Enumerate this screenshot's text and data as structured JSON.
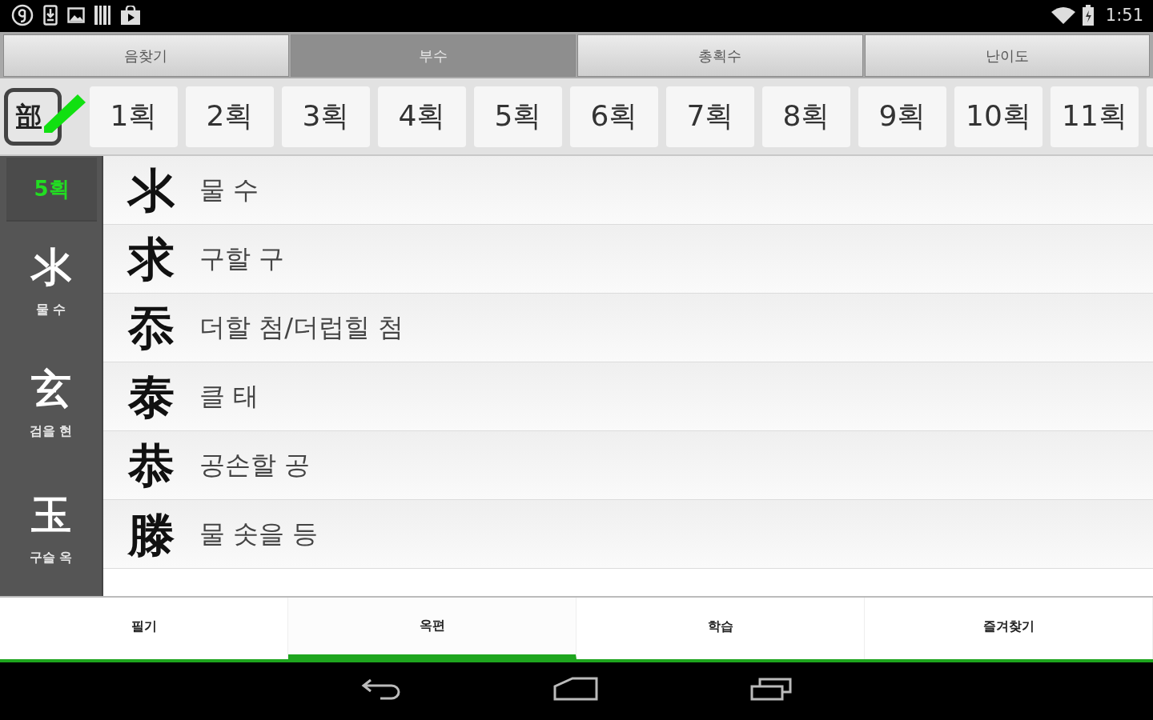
{
  "status_bar": {
    "time": "1:51"
  },
  "top_tabs": [
    {
      "label": "음찾기",
      "selected": false
    },
    {
      "label": "부수",
      "selected": true
    },
    {
      "label": "총획수",
      "selected": false
    },
    {
      "label": "난이도",
      "selected": false
    }
  ],
  "stroke_bar": {
    "radical_button": "部",
    "tiles": [
      "1획",
      "2획",
      "3획",
      "4획",
      "5획",
      "6획",
      "7획",
      "8획",
      "9획",
      "10획",
      "11획"
    ]
  },
  "sidebar": {
    "header": "5획",
    "items": [
      {
        "radical": "氺",
        "reading": "물 수"
      },
      {
        "radical": "玄",
        "reading": "검을 현"
      },
      {
        "radical": "玉",
        "reading": "구슬 옥"
      }
    ]
  },
  "hanja_list": [
    {
      "hanja": "氺",
      "meaning": "물 수"
    },
    {
      "hanja": "求",
      "meaning": "구할 구"
    },
    {
      "hanja": "忝",
      "meaning": "더할 첨/더럽힐 첨"
    },
    {
      "hanja": "泰",
      "meaning": "클 태"
    },
    {
      "hanja": "恭",
      "meaning": "공손할 공"
    },
    {
      "hanja": "滕",
      "meaning": "물 솟을 등"
    }
  ],
  "bottom_tabs": [
    {
      "label": "필기",
      "selected": false
    },
    {
      "label": "옥편",
      "selected": true
    },
    {
      "label": "학습",
      "selected": false
    },
    {
      "label": "즐겨찾기",
      "selected": false
    }
  ]
}
